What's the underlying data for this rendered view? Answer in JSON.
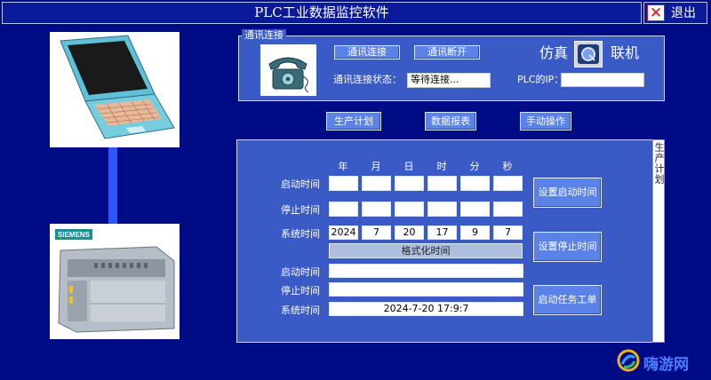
{
  "app": {
    "title": "PLC工业数据监控软件",
    "exit_label": "退出"
  },
  "devices": {
    "plc_brand": "SIEMENS"
  },
  "comm": {
    "group_label": "通讯连接",
    "connect_btn": "通讯连接",
    "disconnect_btn": "通讯断开",
    "status_label": "通讯连接状态：",
    "status_value": "等待连接...",
    "sim_label": "仿真",
    "online_label": "联机",
    "ip_label": "PLC的IP：",
    "ip_value": ""
  },
  "nav": {
    "production_plan": "生产计划",
    "data_report": "数据报表",
    "manual_op": "手动操作"
  },
  "panel": {
    "tab_label": "生产计划",
    "headers": [
      "年",
      "月",
      "日",
      "时",
      "分",
      "秒"
    ],
    "start_time_label": "启动时间",
    "stop_time_label": "停止时间",
    "system_time_label": "系统时间",
    "start_values": [
      "",
      "",
      "",
      "",
      "",
      ""
    ],
    "stop_values": [
      "",
      "",
      "",
      "",
      "",
      ""
    ],
    "system_values": [
      "2024",
      "7",
      "20",
      "17",
      "9",
      "7"
    ],
    "format_btn": "格式化时间",
    "start_formatted": "",
    "stop_formatted": "",
    "system_formatted": "2024-7-20  17:9:7",
    "set_start_btn": "设置启动时间",
    "set_stop_btn": "设置停止时间",
    "start_task_btn": "启动任务工单"
  },
  "watermark": {
    "text": "嗨游网"
  },
  "colors": {
    "background": "#000c86",
    "panel": "#3a5ac6",
    "button": "#5b82e6",
    "link_line": "#2e56ff"
  }
}
